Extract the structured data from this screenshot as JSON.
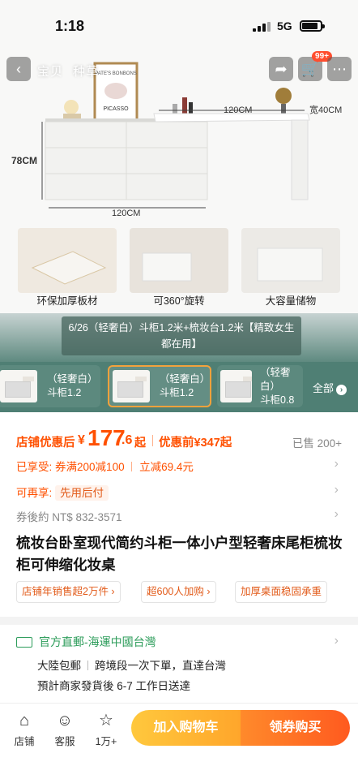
{
  "status_bar": {
    "time": "1:18",
    "network": "5G"
  },
  "nav": {
    "back_icon": "back-arrow",
    "tabs": [
      "宝贝",
      "种草"
    ],
    "share_icon": "share",
    "cart_badge": "99+",
    "more_icon": "more-dots"
  },
  "hero": {
    "dim_height": "78CM",
    "dim_width_bottom": "120CM",
    "dim_top_width": "120CM",
    "dim_depth": "宽40CM",
    "frame_text_1": "PATE'S BONBONS",
    "frame_text_2": "PICASSO",
    "features": [
      "环保加厚板材",
      "可360°旋转",
      "大容量储物"
    ],
    "caption": "6/26（轻奢白）斗柜1.2米+梳妆台1.2米【精致女生都在用】"
  },
  "variants": {
    "items": [
      {
        "line1": "（轻奢白）",
        "line2": "斗柜1.2"
      },
      {
        "line1": "（轻奢白）",
        "line2": "斗柜1.2"
      },
      {
        "line1": "（轻奢白）",
        "line2": "斗柜0.8"
      }
    ],
    "all_label": "全部"
  },
  "price": {
    "prefix": "店铺优惠后",
    "currency": "¥",
    "int": "177",
    "dec": ".6",
    "qi": "起",
    "before": "优惠前¥347起",
    "sold": "已售 200+"
  },
  "promo": {
    "enjoyed_label": "已享受:",
    "enjoyed_text": "券满200减100",
    "enjoyed_text2": "立减69.4元",
    "again_label": "可再享:",
    "again_text": "先用后付",
    "ntd": "券後約 NT$ 832-3571"
  },
  "product_title": "梳妆台卧室现代简约斗柜一体小户型轻奢床尾柜梳妆柜可伸缩化妆桌",
  "tags": [
    "店铺年销售超2万件 ›",
    "超600人加购 ›",
    "加厚桌面稳固承重"
  ],
  "shipping": {
    "head": "官方直郵-海運中國台灣",
    "free": "大陸包郵",
    "cross": "跨境段一次下單，直達台灣",
    "eta": "預計商家發貨後 6-7 工作日送達"
  },
  "bottom": {
    "store": "店铺",
    "service": "客服",
    "fav": "1万+",
    "cart_btn": "加入购物车",
    "buy_btn": "领券购买"
  },
  "colors": {
    "accent": "#ff5000",
    "green": "#4f7f74",
    "cart": "#ffb030",
    "buy": "#ff6a1f"
  }
}
